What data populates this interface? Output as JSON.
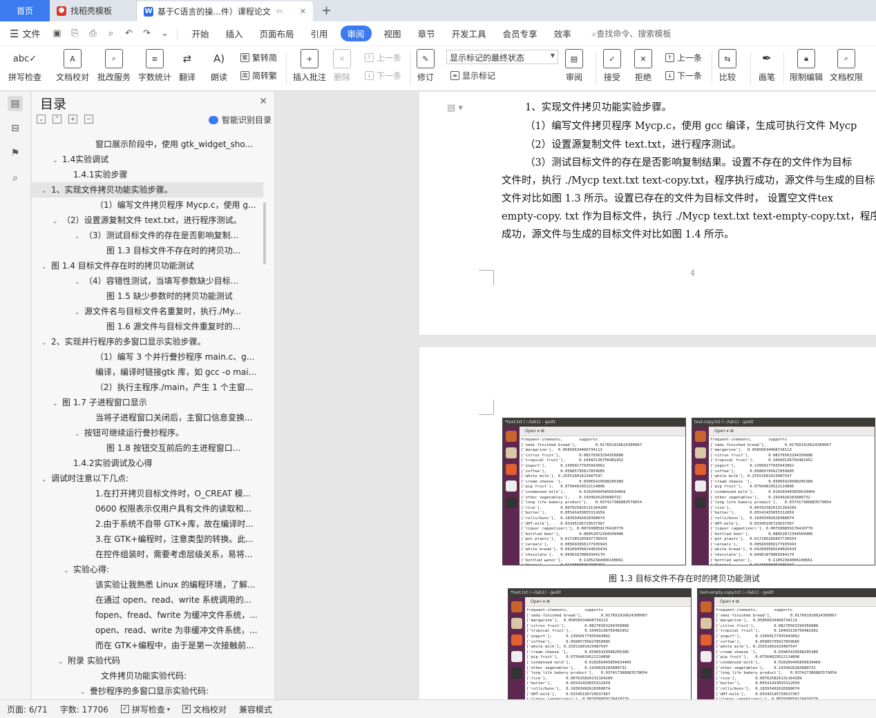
{
  "tabs": {
    "home": "首页",
    "template": "找稻壳模板",
    "doc": "基于C语言的操...件）课程论文",
    "add": "+"
  },
  "menu": {
    "file": "文件",
    "items": [
      "开始",
      "插入",
      "页面布局",
      "引用",
      "审阅",
      "视图",
      "章节",
      "开发工具",
      "会员专享",
      "效率"
    ],
    "active": "审阅",
    "search": "查找命令、搜索模板"
  },
  "ribbon": {
    "spell": "拼写检查",
    "proof": "文档校对",
    "annotate_service": "批改服务",
    "word_count": "字数统计",
    "translate": "翻译",
    "read_aloud": "朗读",
    "to_traditional": "繁转简",
    "to_simplified": "简转繁",
    "insert_comment": "插入批注",
    "delete": "删除",
    "prev_comment": "上一条",
    "next_comment": "下一条",
    "revise": "修订",
    "markup_state": "显示标记的最终状态",
    "show_markup": "显示标记",
    "review": "审阅",
    "accept": "接受",
    "reject": "拒绝",
    "prev_change": "上一条",
    "next_change": "下一条",
    "compare": "比较",
    "pen": "画笔",
    "restrict": "限制编辑",
    "permission": "文档权限"
  },
  "toc": {
    "title": "目录",
    "smart": "智能识别目录",
    "items": [
      {
        "text": "窗口展示阶段中，使用 gtk_widget_sho...",
        "level": 4,
        "caret": ""
      },
      {
        "text": "1.4实验调试",
        "level": 1,
        "caret": "open"
      },
      {
        "text": "1.4.1实验步骤",
        "level": 2,
        "caret": ""
      },
      {
        "text": "1、实现文件拷贝功能实验步骤。",
        "level": 0,
        "caret": "open",
        "selected": true
      },
      {
        "text": "（1）编写文件拷贝程序 Mycp.c，使用 g...",
        "level": 4,
        "caret": ""
      },
      {
        "text": "（2）设置源复制文件 text.txt，进行程序测试。",
        "level": 1,
        "caret": "open"
      },
      {
        "text": "（3）测试目标文件的存在是否影响复制...",
        "level": 3,
        "caret": "open"
      },
      {
        "text": "图 1.3 目标文件不存在时的拷贝功...",
        "level": 5,
        "caret": ""
      },
      {
        "text": "图 1.4 目标文件存在时的拷贝功能测试",
        "level": 0,
        "caret": "open"
      },
      {
        "text": "（4）容错性测试，当填写参数缺少目标...",
        "level": 3,
        "caret": "open"
      },
      {
        "text": "图 1.5 缺少参数时的拷贝功能测试",
        "level": 5,
        "caret": ""
      },
      {
        "text": "源文件名与目标文件名重复时，执行./My...",
        "level": 3,
        "caret": "open"
      },
      {
        "text": "图 1.6 源文件与目标文件重复时的...",
        "level": 5,
        "caret": ""
      },
      {
        "text": "2、实现并行程序的多窗口显示实验步骤。",
        "level": 0,
        "caret": "open"
      },
      {
        "text": "（1）编写 3 个并行誊抄程序 main.c、g...",
        "level": 4,
        "caret": ""
      },
      {
        "text": "编译，编译时链接gtk 库，如 gcc -o mai...",
        "level": 4,
        "caret": ""
      },
      {
        "text": "（2）执行主程序./main，产生 1 个主窗...",
        "level": 4,
        "caret": ""
      },
      {
        "text": "图 1.7 子进程窗口显示",
        "level": 1,
        "caret": "open"
      },
      {
        "text": "当将子进程窗口关闭后，主窗口信息变换...",
        "level": 4,
        "caret": ""
      },
      {
        "text": "按钮可继续运行誊抄程序。",
        "level": 3,
        "caret": "open"
      },
      {
        "text": "图 1.8 按钮交互前后的主进程窗口...",
        "level": 5,
        "caret": ""
      },
      {
        "text": "1.4.2实验调试及心得",
        "level": 2,
        "caret": ""
      },
      {
        "text": "调试时注意以下几点:",
        "level": 0,
        "caret": "open"
      },
      {
        "text": "1.在打开拷贝目标文件时，O_CREAT 模...",
        "level": 4,
        "caret": ""
      },
      {
        "text": "0600 权限表示仅用户具有文件的读取和...",
        "level": 4,
        "caret": ""
      },
      {
        "text": "2.由于系统不自带 GTK+库，故在编译时...",
        "level": 4,
        "caret": ""
      },
      {
        "text": "3.在 GTK+编程时，注意类型的转换。此...",
        "level": 4,
        "caret": ""
      },
      {
        "text": "在控件组装时，需要考虑层级关系，易将...",
        "level": 4,
        "caret": ""
      },
      {
        "text": "实验心得:",
        "level": 2,
        "caret": "open"
      },
      {
        "text": "该实验让我熟悉 Linux 的编程环境，了解...",
        "level": 4,
        "caret": ""
      },
      {
        "text": "在通过 open、read、write 系统调用的...",
        "level": 4,
        "caret": ""
      },
      {
        "text": "fopen、fread、fwrite 为缓冲文件系统，...",
        "level": 4,
        "caret": ""
      },
      {
        "text": "open、read、write 为非缓冲文件系统，...",
        "level": 4,
        "caret": ""
      },
      {
        "text": "而在 GTK+编程中，由于是第一次接触前...",
        "level": 4,
        "caret": ""
      },
      {
        "text": "附录 实验代码",
        "level": 1.5,
        "caret": "open"
      },
      {
        "text": "文件拷贝功能实验代码:",
        "level": 4.5,
        "caret": ""
      },
      {
        "text": "誊抄程序的多窗口显示实验代码:",
        "level": 3.5,
        "caret": "open"
      }
    ]
  },
  "page1": {
    "lines": [
      "1、实现文件拷贝功能实验步骤。",
      "（1）编写文件拷贝程序  Mycp.c，使用  gcc 编译，生成可执行文件  Mycp",
      "（2）设置源复制文件  text.txt，进行程序测试。",
      "（3）测试目标文件的存在是否影响复制结果。设置不存在的文件作为目标",
      "文件时，执行 ./Mycp text.txt text-copy.txt，程序执行成功，源文件与生成的目标",
      "文件对比如图  1.3 所示。设置已存在的文件为目标文件时，  设置空文件tex",
      "empty-copy. txt 作为目标文件，执行 ./Mycp text.txt text-empty-copy.txt，程序执行",
      "成功，源文件与生成的目标文件对比如图  1.4 所示。"
    ],
    "page_number": "4"
  },
  "page2": {
    "caption": "图  1.3 目标文件不存在时的拷贝功能测试",
    "shots": [
      {
        "title": "*text.txt (~/lab1) - gedit",
        "toolbar": "Open ▾   ⊞"
      },
      {
        "title": "text-copy.txt (~/lab1) - gedit",
        "toolbar": "Open ▾   ⊞"
      },
      {
        "title": "*text.txt (~/lab1) - gedit",
        "toolbar": "Open ▾   ⊞"
      },
      {
        "title": "text-empty-copy.txt (~/lab1) - gedit",
        "toolbar": "Open ▾   ⊞"
      }
    ],
    "code_lines": [
      "frequent-itemsets,       supports",
      "['semi-finished bread'],        0.017691916624300967",
      "['margarine'],  0.05856634468734113",
      "['citrus fruit'],        0.08276563294356888",
      "['tropical fruit'],      0.10493136756481952",
      "['yogurt'],      0.13950177935943062",
      "['coffee'],      0.05805795627859685",
      "['whole milk'], 0.25551601423487547",
      "['cream cheese '],       0.03965429588205389",
      "['pip fruit'],   0.07564819522114896",
      "['condensed milk'],      0.010269445856634469",
      "['other vegetables'],    0.1934926283680732",
      "['long life bakery product'],   0.037417386883579054",
      "['rice'],        0.007625826131164289",
      "['butter'],      0.05541433655312659",
      "['rolls/buns'],  0.18393492628368074",
      "['UHT-milk'],    0.03345195729537367",
      "['liquor (appetizer)'], 0.007930859176410779",
      "['bottled beer'],        0.08052872394509406",
      "['pot plants'],  0.017285205897730554",
      "['cereals'],     0.005693950177935943",
      "['white bread'], 0.042094560244026434",
      "['chocolate'],   0.04961870869344179",
      "['bottled water'],       0.11052364006100661",
      "['flour'],       0.01738688357905397"
    ]
  },
  "status": {
    "page": "页面: 6/71",
    "words": "字数: 17706",
    "spell": "拼写检查",
    "proof": "文档校对",
    "compat": "兼容模式"
  },
  "colors": {
    "accent": "#3b7bf0",
    "tab_bar": "#dfe3ea",
    "launcher": "#5e2750"
  }
}
